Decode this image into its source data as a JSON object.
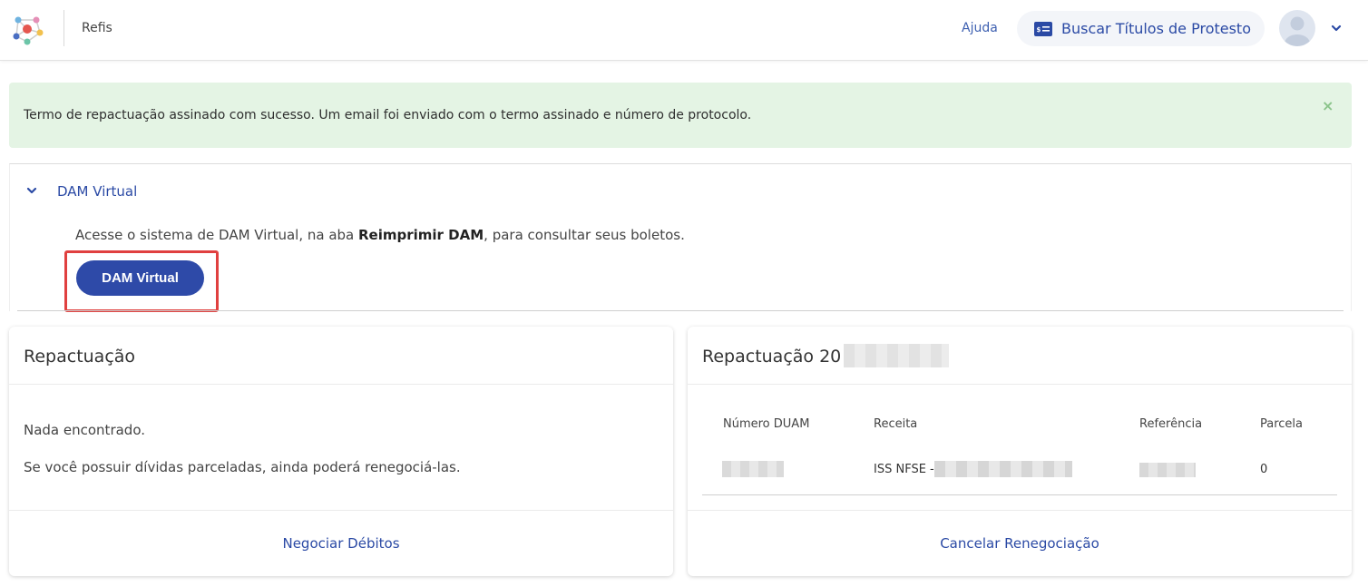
{
  "header": {
    "app_name": "Refis",
    "help_label": "Ajuda",
    "protest_button_label": "Buscar Títulos de Protesto"
  },
  "alert": {
    "message": "Termo de repactuação assinado com sucesso. Um email foi enviado com o termo assinado e número de protocolo.",
    "close_symbol": "×"
  },
  "dam_section": {
    "title": "DAM Virtual",
    "description_before": "Acesse o sistema de DAM Virtual, na aba ",
    "description_bold": "Reimprimir DAM",
    "description_after": ", para consultar seus boletos.",
    "button_label": "DAM Virtual"
  },
  "left_card": {
    "title": "Repactuação",
    "line1": "Nada encontrado.",
    "line2": "Se você possuir dívidas parceladas, ainda poderá renegociá-las.",
    "footer_link": "Negociar Débitos"
  },
  "right_card": {
    "title": "Repactuação 20",
    "columns": [
      "Número DUAM",
      "Receita",
      "Referência",
      "Parcela"
    ],
    "row": {
      "receita_prefix": "ISS NFSE -",
      "parcela": "0"
    },
    "footer_link": "Cancelar Renegociação"
  },
  "colors": {
    "brand": "#2e4aa8",
    "link": "#2b4aa5",
    "alert_bg": "#e4f4e4",
    "highlight": "#e0403f"
  },
  "icons": [
    "logo-icon",
    "id-card-icon",
    "user-avatar-icon",
    "chevron-down-icon",
    "close-icon"
  ]
}
